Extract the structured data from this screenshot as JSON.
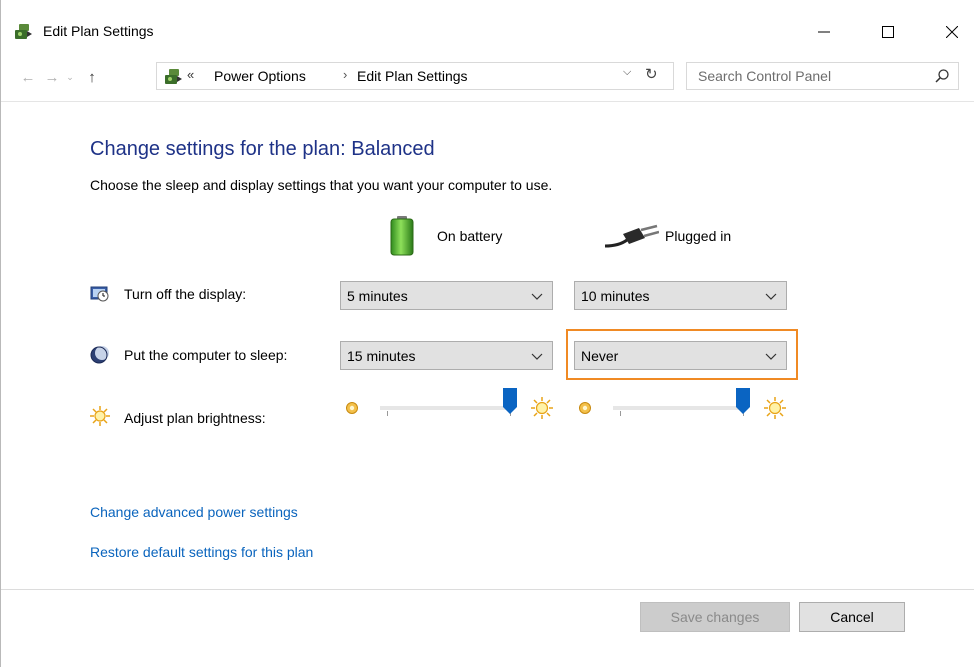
{
  "window": {
    "title": "Edit Plan Settings",
    "icon": "power-plan-icon",
    "controls": {
      "minimize": "minimize-icon",
      "maximize": "maximize-icon",
      "close": "close-icon"
    }
  },
  "addressbar": {
    "back_icon": "←",
    "forward_icon": "→",
    "recent_icon": "⌄",
    "up_icon": "↑",
    "overflow": "«",
    "separator": "›",
    "breadcrumb": [
      "Power Options",
      "Edit Plan Settings"
    ],
    "dropdown_icon": "⌵",
    "refresh_icon": "↻",
    "search_placeholder": "Search Control Panel"
  },
  "content": {
    "title": "Change settings for the plan: Balanced",
    "description": "Choose the sleep and display settings that you want your computer to use.",
    "columns": {
      "battery": "On battery",
      "plugged": "Plugged in"
    },
    "rows": {
      "display": {
        "label": "Turn off the display:",
        "battery_value": "5 minutes",
        "plugged_value": "10 minutes"
      },
      "sleep": {
        "label": "Put the computer to sleep:",
        "battery_value": "15 minutes",
        "plugged_value": "Never"
      },
      "brightness": {
        "label": "Adjust plan brightness:",
        "battery_level": 1.0,
        "plugged_level": 1.0
      }
    },
    "links": {
      "advanced": "Change advanced power settings",
      "restore": "Restore default settings for this plan"
    }
  },
  "footer": {
    "save_label": "Save changes",
    "cancel_label": "Cancel"
  },
  "colors": {
    "title_blue": "#1e3287",
    "link_blue": "#0a64bd",
    "highlight_orange": "#f08a24",
    "slider_thumb": "#0a64c2"
  }
}
